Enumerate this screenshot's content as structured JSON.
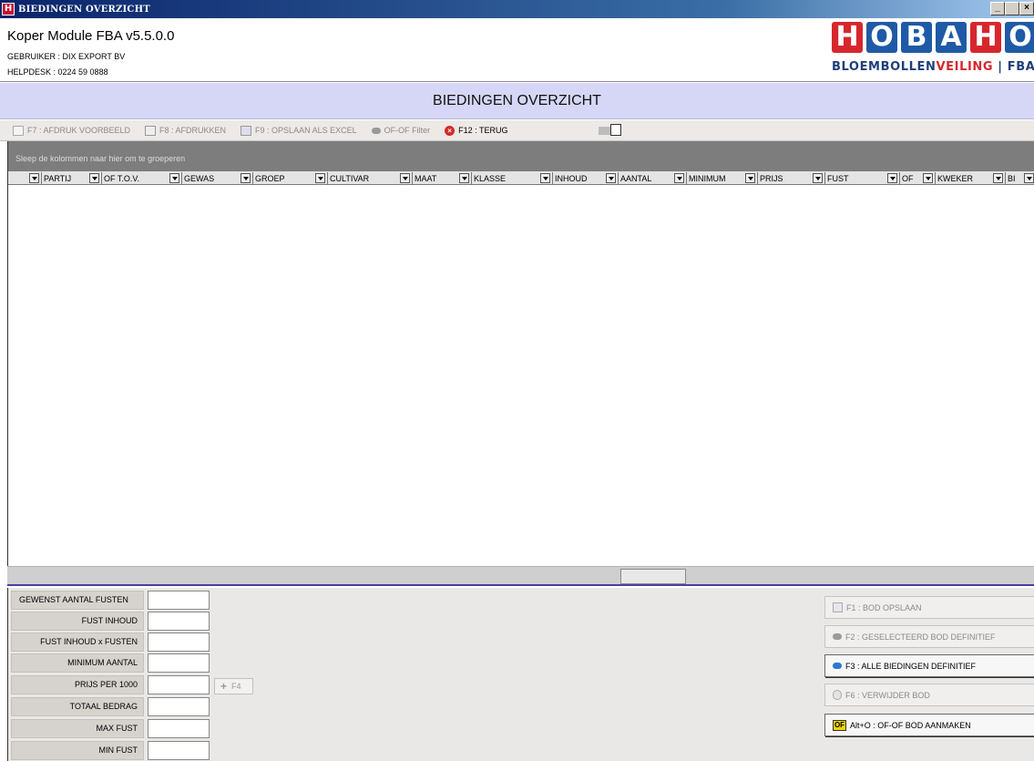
{
  "window": {
    "title": "BIEDINGEN OVERZICHT",
    "app_icon_letter": "H",
    "minimize": "_",
    "maximize": " ",
    "close": "×"
  },
  "header": {
    "app_name": "Koper Module FBA v5.5.0.0",
    "user": "GEBRUIKER : DIX EXPORT BV",
    "helpdesk": "HELPDESK : 0224 59 0888",
    "logo_letters": [
      "H",
      "O",
      "B",
      "A",
      "H",
      "O"
    ],
    "logo_sub_a": "BLOEMBOLLEN",
    "logo_sub_b": "VEILING",
    "logo_sub_c": " | FBA"
  },
  "page_title": "BIEDINGEN OVERZICHT",
  "toolbar": {
    "preview": "F7 : AFDRUK VOORBEELD",
    "print": "F8 : AFDRUKKEN",
    "excel": "F9 : OPSLAAN ALS EXCEL",
    "of_filter": "OF-OF Filter",
    "back": "F12 : TERUG"
  },
  "grid": {
    "group_hint": "Sleep de kolommen naar hier om te groeperen",
    "columns": [
      "PARTIJ",
      "OF T.O.V.",
      "GEWAS",
      "GROEP",
      "CULTIVAR",
      "MAAT",
      "KLASSE",
      "INHOUD",
      "AANTAL",
      "MINIMUM",
      "PRIJS",
      "FUST",
      "OF",
      "KWEKER",
      "BI",
      ""
    ]
  },
  "form": {
    "fields": [
      {
        "label": "GEWENST AANTAL FUSTEN",
        "value": ""
      },
      {
        "label": "FUST INHOUD",
        "value": ""
      },
      {
        "label": "FUST INHOUD x FUSTEN",
        "value": ""
      },
      {
        "label": "MINIMUM AANTAL",
        "value": ""
      },
      {
        "label": "PRIJS PER 1000",
        "value": ""
      },
      {
        "label": "TOTAAL BEDRAG",
        "value": ""
      },
      {
        "label": "MAX FUST",
        "value": ""
      },
      {
        "label": "MIN FUST",
        "value": ""
      }
    ],
    "f4_label": "F4",
    "f4_plus": "+"
  },
  "actions": {
    "f1": "F1 : BOD OPSLAAN",
    "f2": "F2 : GESELECTEERD BOD DEFINITIEF",
    "f3": "F3 : ALLE BIEDINGEN DEFINITIEF",
    "f6": "F6 : VERWIJDER BOD",
    "alt_o": "Alt+O : OF-OF BOD AANMAKEN",
    "of_badge": "OF"
  }
}
